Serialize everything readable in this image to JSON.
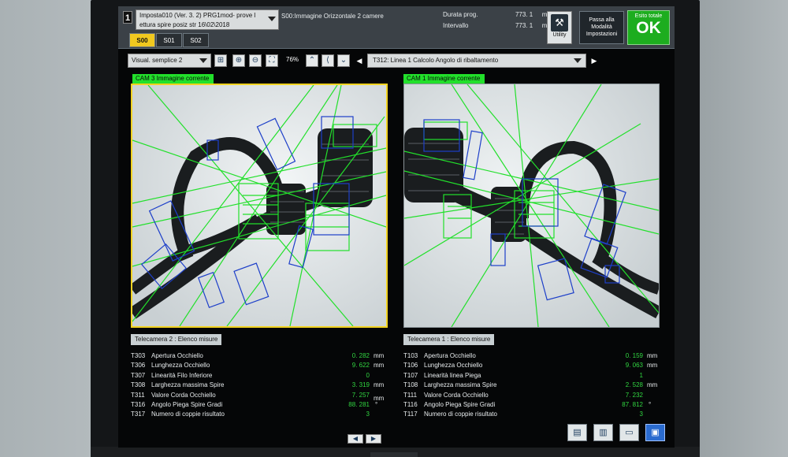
{
  "header": {
    "program_number": "1",
    "program_line1": "Imposta010 (Ver. 3. 2) PRG1mod- prove l",
    "program_line2": "ettura spire posiz str 16\\02\\2018",
    "image_info": "S00:Immagine Orizzontale 2 camere",
    "timing": [
      {
        "label": "Durata prog.",
        "value": "773. 1",
        "unit": "ms"
      },
      {
        "label": "Intervallo",
        "value": "773. 1",
        "unit": "ms"
      }
    ],
    "tabs": [
      "S00",
      "S01",
      "S02"
    ],
    "active_tab": "S00",
    "utility_label": "Utility",
    "passa_label_1": "Passa alla",
    "passa_label_2": "Modalità",
    "passa_label_3": "Impostazioni",
    "esito_title": "Esito totale",
    "esito_value": "OK"
  },
  "toolbar": {
    "visual_select": "Visual. semplice 2",
    "zoom": "76%",
    "tool_select": "T312: Linea 1 Calcolo Angolo di ribaltamento",
    "prev_arrow": "◀",
    "next_arrow": "▶"
  },
  "cameras": {
    "left_label": "CAM 3 Immagine corrente",
    "right_label": "CAM 1 Immagine corrente"
  },
  "measures_left": {
    "title": "Telecamera 2 : Elenco misure",
    "rows": [
      {
        "code": "T303",
        "name": "Apertura Occhiello",
        "value": "0. 282",
        "unit": "mm"
      },
      {
        "code": "T306",
        "name": "Lunghezza Occhiello",
        "value": "9. 622",
        "unit": "mm"
      },
      {
        "code": "T307",
        "name": "Linearità Filo Inferiore",
        "value": "0",
        "unit": ""
      },
      {
        "code": "T308",
        "name": "Larghezza massima Spire",
        "value": "3. 319",
        "unit": "mm"
      },
      {
        "code": "T311",
        "name": "Valore Corda Occhiello",
        "value": "7. 257",
        "unit": "mm"
      },
      {
        "code": "T316",
        "name": "Angolo Piega Spire Gradi",
        "value": "88. 281",
        "unit": "°"
      },
      {
        "code": "T317",
        "name": "Numero di coppie risultato",
        "value": "3",
        "unit": ""
      }
    ]
  },
  "measures_right": {
    "title": "Telecamera 1 : Elenco misure",
    "rows": [
      {
        "code": "T103",
        "name": "Apertura Occhiello",
        "value": "0. 159",
        "unit": "mm"
      },
      {
        "code": "T106",
        "name": "Lunghezza Occhiello",
        "value": "9. 063",
        "unit": "mm"
      },
      {
        "code": "T107",
        "name": "Linearità linea Piega",
        "value": "1",
        "unit": ""
      },
      {
        "code": "T108",
        "name": "Larghezza massima Spire",
        "value": "2. 528",
        "unit": "mm"
      },
      {
        "code": "T111",
        "name": "Valore Corda Occhiello",
        "value": "7. 232",
        "unit": ""
      },
      {
        "code": "T116",
        "name": "Angolo Piega Spire Gradi",
        "value": "87. 812",
        "unit": "°"
      },
      {
        "code": "T117",
        "name": "Numero di coppie risultato",
        "value": "3",
        "unit": ""
      }
    ]
  },
  "pager": {
    "prev": "◀",
    "next": "▶"
  },
  "colors": {
    "ok_green": "#1dad1f",
    "overlay_green": "#22e02b",
    "overlay_blue": "#1d3fc9",
    "active_tab": "#f0c81f"
  }
}
